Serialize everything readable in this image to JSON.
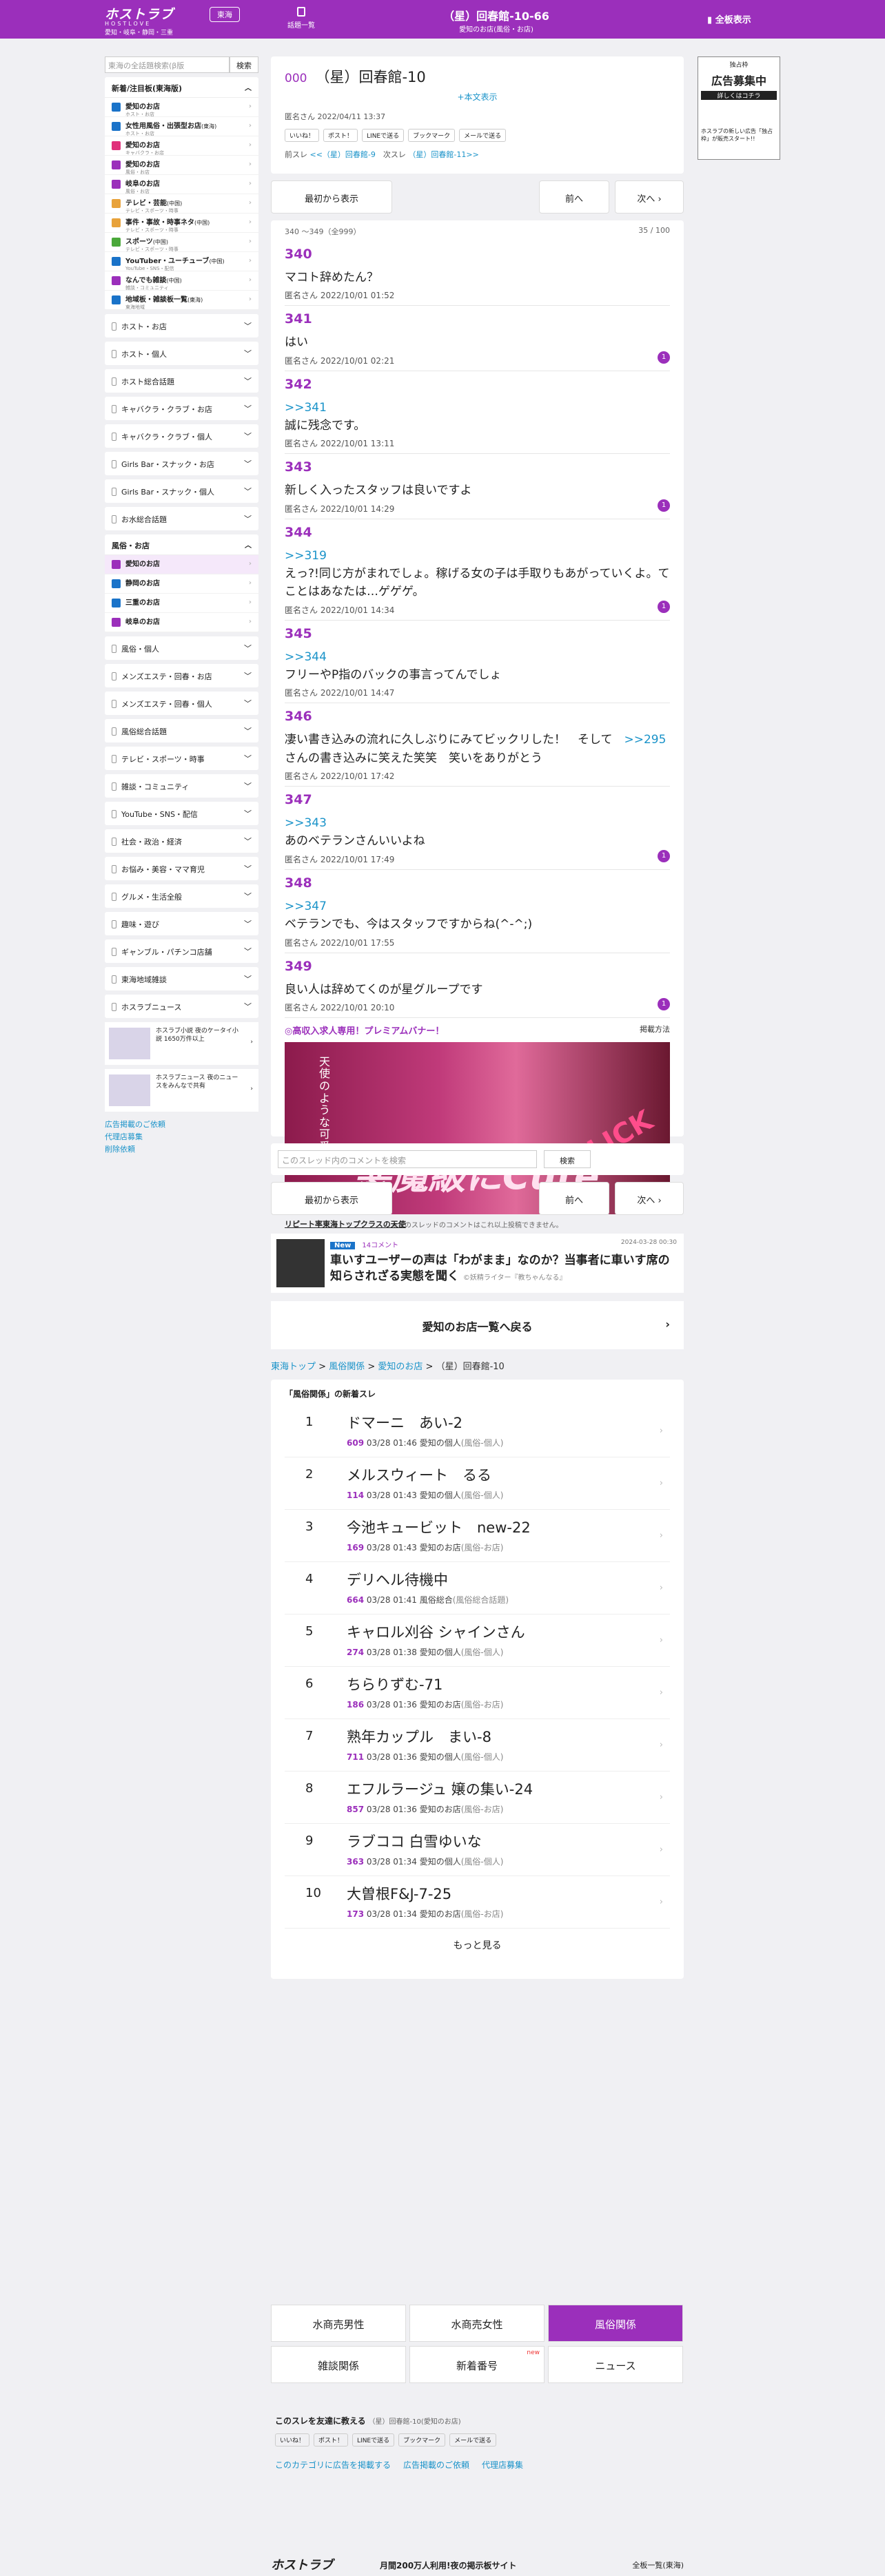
{
  "header": {
    "logo": "ホストラブ",
    "logo_sub": "HOSTLOVE",
    "logo_area": "愛知・岐阜・静岡・三重",
    "area": "東海",
    "list_label": "話題一覧",
    "title": "（星）回春館-10-66",
    "subtitle": "愛知のお店(風俗・お店)",
    "full": "全板表示"
  },
  "sidebar": {
    "search_placeholder": "東海の全話題検索(β版",
    "search_btn": "検索",
    "group_title": "新着/注目板(東海版)",
    "items": [
      {
        "label": "愛知のお店",
        "sub": "ホスト・お店",
        "color": "#1a73c9"
      },
      {
        "label": "女性用風俗・出張型お店",
        "tag": "(東海)",
        "sub": "ホスト・お店",
        "color": "#1a73c9"
      },
      {
        "label": "愛知のお店",
        "sub": "キャバクラ・お店",
        "color": "#e0307a"
      },
      {
        "label": "愛知のお店",
        "sub": "風俗・お店",
        "color": "#9b2fbb"
      },
      {
        "label": "岐阜のお店",
        "sub": "風俗・お店",
        "color": "#9b2fbb"
      },
      {
        "label": "テレビ・芸能",
        "tag": "(中国)",
        "sub": "テレビ・スポーツ・時事",
        "color": "#e8a23a"
      },
      {
        "label": "事件・事故・時事ネタ",
        "tag": "(中国)",
        "sub": "テレビ・スポーツ・時事",
        "color": "#e8a23a"
      },
      {
        "label": "スポーツ",
        "tag": "(中国)",
        "sub": "テレビ・スポーツ・時事",
        "color": "#4aa83a"
      },
      {
        "label": "YouTuber・ユーチューブ",
        "tag": "(中国)",
        "sub": "YouTube・SNS・配信",
        "color": "#1a73c9"
      },
      {
        "label": "なんでも雑談",
        "tag": "(中国)",
        "sub": "雑談・コミュニティ",
        "color": "#9b2fbb"
      },
      {
        "label": "地域板・雑談板一覧",
        "tag": "(東海)",
        "sub": "東海地域",
        "color": "#1a73c9"
      }
    ],
    "cats1": [
      "ホスト・お店",
      "ホスト・個人",
      "ホスト総合話題",
      "キャバクラ・クラブ・お店",
      "キャバクラ・クラブ・個人",
      "Girls Bar・スナック・お店",
      "Girls Bar・スナック・個人",
      "お水総合話題"
    ],
    "fuzoku_title": "風俗・お店",
    "fuzoku_items": [
      "愛知のお店",
      "静岡のお店",
      "三重のお店",
      "岐阜のお店"
    ],
    "cats2": [
      "風俗・個人",
      "メンズエステ・回春・お店",
      "メンズエステ・回春・個人",
      "風俗総合話題",
      "テレビ・スポーツ・時事",
      "雑談・コミュニティ",
      "YouTube・SNS・配信",
      "社会・政治・経済",
      "お悩み・美容・ママ育児",
      "グルメ・生活全般",
      "趣味・遊び",
      "ギャンブル・パチンコ店舗",
      "東海地域雑談",
      "ホスラブニュース"
    ],
    "banner1": "ホスラブ小説 夜のケータイ小説 1650万件以上",
    "banner2": "ホスラブニュース 夜のニュースをみんなで共有",
    "links": [
      "広告掲載のご依頼",
      "代理店募集",
      "削除依頼"
    ]
  },
  "thread": {
    "no": "000",
    "title": "（星）回春館-10",
    "more": "+本文表示",
    "meta": "匿名さん 2022/04/11 13:37",
    "shares": [
      "いいね！",
      "ポスト！",
      "LINEで送る",
      "ブックマーク",
      "メールで送る"
    ],
    "prev_label": "前スレ",
    "prev": "<<（星）回春館-9",
    "next_label": "次スレ",
    "next": "（星）回春館-11>>"
  },
  "nav": {
    "first": "最初から表示",
    "prev": "前へ",
    "next": "次へ"
  },
  "range": {
    "text": "340 〜349（全999）",
    "page": "35 / 100"
  },
  "posts": [
    {
      "no": "340",
      "body": "マコト辞めたん？",
      "meta": "匿名さん 2022/10/01 01:52"
    },
    {
      "no": "341",
      "body": "はい",
      "meta": "匿名さん 2022/10/01 02:21",
      "badge": "1"
    },
    {
      "no": "342",
      "anchor": ">>341",
      "body": "誠に残念です。",
      "meta": "匿名さん 2022/10/01 13:11"
    },
    {
      "no": "343",
      "body": "新しく入ったスタッフは良いですよ",
      "meta": "匿名さん 2022/10/01 14:29",
      "badge": "1"
    },
    {
      "no": "344",
      "anchor": ">>319",
      "body": "えっ?!同じ方がまれでしょ。稼げる女の子は手取りもあがっていくよ。てことはあなたは…ゲゲゲ。",
      "meta": "匿名さん 2022/10/01 14:34",
      "badge": "1"
    },
    {
      "no": "345",
      "anchor": ">>344",
      "body": "フリーやP指のバックの事言ってんでしょ",
      "meta": "匿名さん 2022/10/01 14:47"
    },
    {
      "no": "346",
      "body_a": "凄い書き込みの流れに久しぶりにみてビックリした！　そして　",
      "inline": ">>295",
      "body_b": " さんの書き込みに笑えた笑笑　笑いをありがとう",
      "meta": "匿名さん 2022/10/01 17:42"
    },
    {
      "no": "347",
      "anchor": ">>343",
      "body": "あのベテランさんいいよね",
      "meta": "匿名さん 2022/10/01 17:49",
      "badge": "1"
    },
    {
      "no": "348",
      "anchor": ">>347",
      "body": "ベテランでも、今はスタッフですからね(^-^;)",
      "meta": "匿名さん 2022/10/01 17:55"
    },
    {
      "no": "349",
      "body": "良い人は辞めてくのが星グループです",
      "meta": "匿名さん 2022/10/01 20:10",
      "badge": "1"
    }
  ],
  "promo": {
    "head": "◎高収入求人専用！プレミアムバナー！",
    "how": "掲載方法",
    "big": "悪魔級にCute",
    "click": "CLICK",
    "v1": "天使のような可愛さ",
    "caption": "リピート率東海トップクラスの天使"
  },
  "search": {
    "placeholder": "このスレッド内のコメントを検索",
    "btn": "検索"
  },
  "notice": "※このスレッドのコメントはこれ以上投稿できません。",
  "news": {
    "tag": "New",
    "comments": "14コメント",
    "date": "2024-03-28 00:30",
    "title": "車いすユーザーの声は「わがまま」なのか？当事者に車いす席の知らされざる実態を聞く",
    "src": "©妖精ライター『教ちゃんなる』"
  },
  "back": "愛知のお店一覧へ戻る",
  "breadcrumb": {
    "a": "東海トップ",
    "b": "風俗関係",
    "c": "愛知のお店",
    "cur": "（星）回春館-10"
  },
  "new_threads": {
    "head": "「風俗関係」の新着スレ",
    "items": [
      {
        "rank": "1",
        "title": "ドマーニ　あい-2",
        "count": "609",
        "time": "03/28 01:46",
        "board": "愛知の個人",
        "cat": "(風俗-個人)"
      },
      {
        "rank": "2",
        "title": "メルスウィート　るる",
        "count": "114",
        "time": "03/28 01:43",
        "board": "愛知の個人",
        "cat": "(風俗-個人)"
      },
      {
        "rank": "3",
        "title": "今池キュービット　new-22",
        "count": "169",
        "time": "03/28 01:43",
        "board": "愛知のお店",
        "cat": "(風俗-お店)"
      },
      {
        "rank": "4",
        "title": "デリヘル待機中",
        "count": "664",
        "time": "03/28 01:41",
        "board": "風俗総合",
        "cat": "(風俗総合話題)"
      },
      {
        "rank": "5",
        "title": "キャロル刈谷 シャインさん",
        "count": "274",
        "time": "03/28 01:38",
        "board": "愛知の個人",
        "cat": "(風俗-個人)"
      },
      {
        "rank": "6",
        "title": "ちらりずむ-71",
        "count": "186",
        "time": "03/28 01:36",
        "board": "愛知のお店",
        "cat": "(風俗-お店)"
      },
      {
        "rank": "7",
        "title": "熟年カップル　まい-8",
        "count": "711",
        "time": "03/28 01:36",
        "board": "愛知の個人",
        "cat": "(風俗-個人)"
      },
      {
        "rank": "8",
        "title": "エフルラージュ 嬢の集い-24",
        "count": "857",
        "time": "03/28 01:36",
        "board": "愛知のお店",
        "cat": "(風俗-お店)"
      },
      {
        "rank": "9",
        "title": "ラブココ 白雪ゆいな",
        "count": "363",
        "time": "03/28 01:34",
        "board": "愛知の個人",
        "cat": "(風俗-個人)"
      },
      {
        "rank": "10",
        "title": "大曽根F&J-7-25",
        "count": "173",
        "time": "03/28 01:34",
        "board": "愛知のお店",
        "cat": "(風俗-お店)"
      }
    ],
    "more": "もっと見る"
  },
  "gnav": {
    "items": [
      "水商売男性",
      "水商売女性",
      "風俗関係",
      "雑談関係",
      "新着番号",
      "ニュース"
    ],
    "new": "new"
  },
  "footer": {
    "share_title": "このスレを友達に教える",
    "share_sub": "（星）回春館-10(愛知のお店)",
    "links": [
      "このカテゴリに広告を掲載する",
      "広告掲載のご依頼",
      "代理店募集"
    ],
    "logo": "ホストラブ",
    "tagline": "月間200万人利用!夜の掲示板サイト",
    "right": "全板一覧(東海)"
  },
  "ad": {
    "top": "独占枠",
    "main": "広告募集中",
    "mid": "詳しくはコチラ",
    "foot": "ホスラブの新しい広告「独占枠」が販売スタート!!"
  }
}
